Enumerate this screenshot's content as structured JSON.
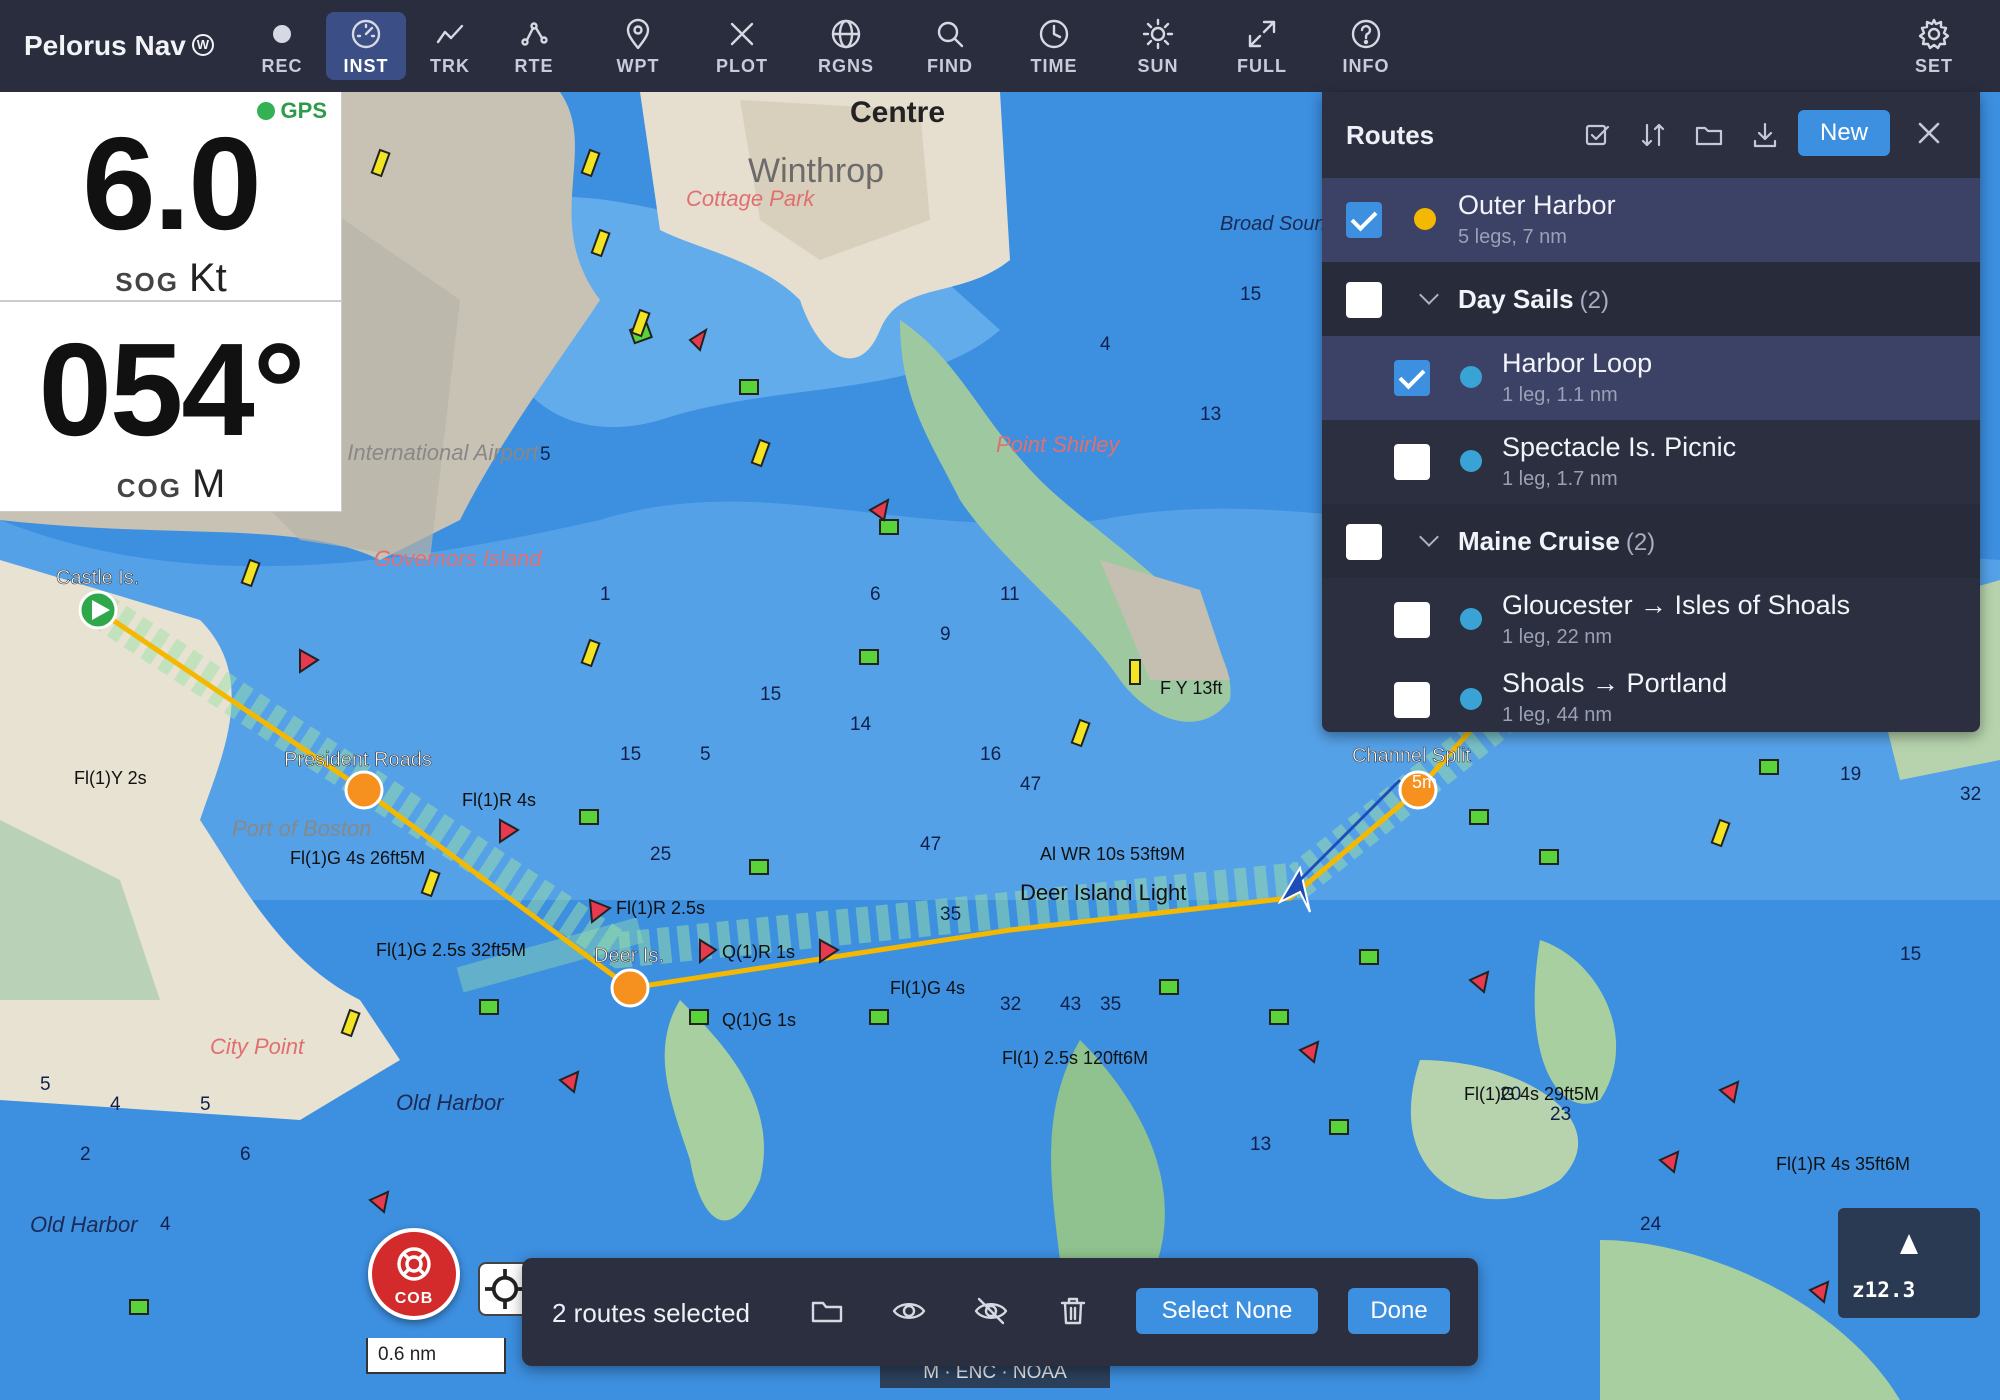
{
  "app": {
    "title": "Pelorus Nav",
    "badge": "W"
  },
  "toolbar": [
    {
      "id": "rec",
      "label": "REC",
      "icon": "record-icon",
      "active": false
    },
    {
      "id": "inst",
      "label": "INST",
      "icon": "gauge-icon",
      "active": true
    },
    {
      "id": "trk",
      "label": "TRK",
      "icon": "track-icon",
      "active": false
    },
    {
      "id": "rte",
      "label": "RTE",
      "icon": "route-icon",
      "active": false
    },
    {
      "id": "wpt",
      "label": "WPT",
      "icon": "map-pin-icon",
      "active": false
    },
    {
      "id": "plot",
      "label": "PLOT",
      "icon": "plot-x-icon",
      "active": false
    },
    {
      "id": "rgns",
      "label": "RGNS",
      "icon": "globe-icon",
      "active": false
    },
    {
      "id": "find",
      "label": "FIND",
      "icon": "search-icon",
      "active": false
    },
    {
      "id": "time",
      "label": "TIME",
      "icon": "clock-icon",
      "active": false
    },
    {
      "id": "sun",
      "label": "SUN",
      "icon": "sun-icon",
      "active": false
    },
    {
      "id": "full",
      "label": "FULL",
      "icon": "fullscreen-icon",
      "active": false
    },
    {
      "id": "info",
      "label": "INFO",
      "icon": "help-icon",
      "active": false
    },
    {
      "id": "set",
      "label": "SET",
      "icon": "gear-icon",
      "active": false
    }
  ],
  "instrument": {
    "gps": "GPS",
    "sog": {
      "value": "6.0",
      "label": "SOG",
      "unit": "Kt"
    },
    "cog": {
      "value": "054°",
      "label": "COG",
      "unit": "M"
    }
  },
  "routes_panel": {
    "title": "Routes",
    "new_label": "New",
    "items": [
      {
        "type": "route",
        "name": "Outer Harbor",
        "sub": "5 legs, 7 nm",
        "checked": true,
        "dot": "#f5b800",
        "selected": true
      },
      {
        "type": "group",
        "name": "Day Sails",
        "count": "(2)",
        "checked": false
      },
      {
        "type": "route",
        "name": "Harbor Loop",
        "sub": "1 leg, 1.1 nm",
        "checked": true,
        "dot": "#3aa3d6",
        "selected": true
      },
      {
        "type": "route",
        "name": "Spectacle Is. Picnic",
        "sub": "1 leg, 1.7 nm",
        "checked": false,
        "dot": "#3aa3d6",
        "selected": false
      },
      {
        "type": "group",
        "name": "Maine Cruise",
        "count": "(2)",
        "checked": false
      },
      {
        "type": "route",
        "name": "Gloucester → Isles of Shoals",
        "sub": "1 leg, 22 nm",
        "checked": false,
        "dot": "#3aa3d6",
        "selected": false
      },
      {
        "type": "route",
        "name": "Shoals → Portland",
        "sub": "1 leg, 44 nm",
        "checked": false,
        "dot": "#3aa3d6",
        "selected": false
      }
    ]
  },
  "action_bar": {
    "status": "2 routes selected",
    "select_none": "Select None",
    "done": "Done"
  },
  "cob": {
    "label": "COB"
  },
  "scale": "0.6 nm",
  "zoom": {
    "level": "z12.3"
  },
  "attribution": "M · ENC · NOAA",
  "map_labels": [
    {
      "t": "Centre"
    },
    {
      "t": "Winthrop"
    },
    {
      "t": "Cottage Park"
    },
    {
      "t": "Point Shirley"
    },
    {
      "t": "Governors Island"
    },
    {
      "t": "Castle Is."
    },
    {
      "t": "President Roads"
    },
    {
      "t": "Port of Boston"
    },
    {
      "t": "Deer Is."
    },
    {
      "t": "Deer Island Light"
    },
    {
      "t": "Channel Split"
    },
    {
      "t": "City Point"
    },
    {
      "t": "Old Harbor"
    },
    {
      "t": "Logan International Airport"
    },
    {
      "t": "Broad Sound"
    },
    {
      "t": "Al WR 10s 53ft9M"
    },
    {
      "t": "Fl(1)G 2.5s 32ft5M"
    },
    {
      "t": "Fl(1)G 4s 26ft5M"
    },
    {
      "t": "Fl(1) 2.5s 120ft6M"
    },
    {
      "t": "Fl(1)G 4s 29ft5M"
    },
    {
      "t": "Fl(1)R 4s 35ft6M"
    },
    {
      "t": "Q(1)R 1s"
    },
    {
      "t": "Q(1)G 1s"
    },
    {
      "t": "Fl(1)G 4s"
    },
    {
      "t": "Fl(1)R 2.5s"
    },
    {
      "t": "Fl(1)Y 2s"
    },
    {
      "t": "Fl(1)R 4s"
    },
    {
      "t": "F Y 13ft"
    },
    {
      "t": "5m"
    }
  ]
}
